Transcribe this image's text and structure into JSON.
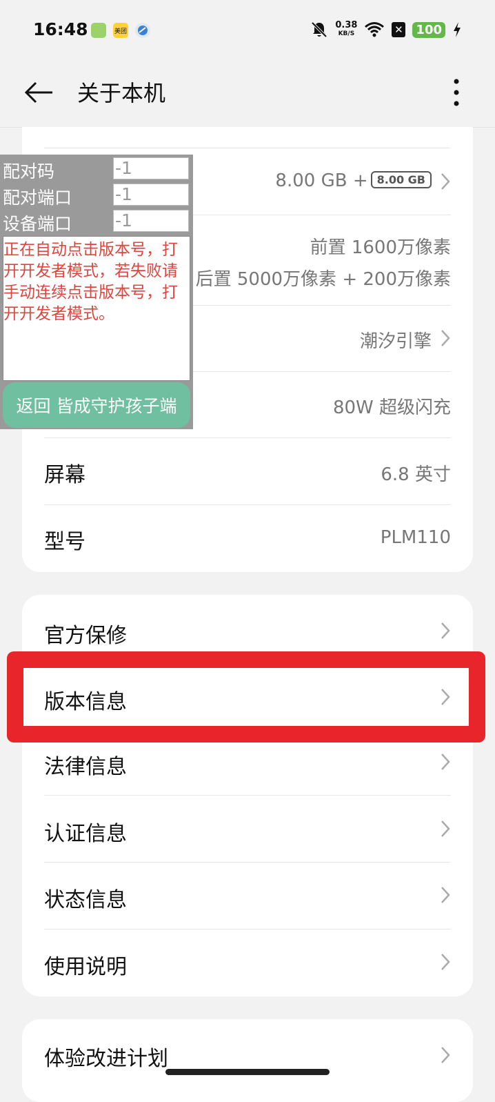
{
  "status_bar": {
    "time": "16:48",
    "app_badges": [
      "美团"
    ],
    "net_speed_value": "0.38",
    "net_speed_unit": "KB/S",
    "battery": "100",
    "icons": [
      "mute-icon",
      "wifi-icon",
      "sim-off-icon",
      "charging-icon"
    ]
  },
  "app_bar": {
    "title": "关于本机"
  },
  "card1": {
    "memory_value": "8.00 GB +",
    "memory_chip": "8.00 GB",
    "camera_front": "前置 1600万像素",
    "camera_rear": "后置 5000万像素 + 200万像素",
    "engine_value": "潮汐引擎",
    "charge_value": "80W 超级闪充",
    "screen_label": "屏幕",
    "screen_value": "6.8 英寸",
    "model_label": "型号",
    "model_value": "PLM110"
  },
  "card2": {
    "items": [
      {
        "label": "官方保修"
      },
      {
        "label": "版本信息"
      },
      {
        "label": "法律信息"
      },
      {
        "label": "认证信息"
      },
      {
        "label": "状态信息"
      },
      {
        "label": "使用说明"
      }
    ]
  },
  "card3": {
    "items": [
      {
        "label": "体验改进计划"
      }
    ]
  },
  "overlay": {
    "pair_code_label": "配对码",
    "pair_code_value": "-1",
    "pair_port_label": "配对端口",
    "pair_port_value": "-1",
    "device_port_label": "设备端口",
    "device_port_value": "-1",
    "message": "正在自动点击版本号，打开开发者模式，若失败请手动连续点击版本号，打开开发者模式。",
    "button_label": "返回 皆成守护孩子端"
  },
  "colors": {
    "highlight": "#e8252a",
    "overlay_button": "#6fbfa0",
    "message_text": "#e0443c",
    "battery": "#62b848"
  }
}
